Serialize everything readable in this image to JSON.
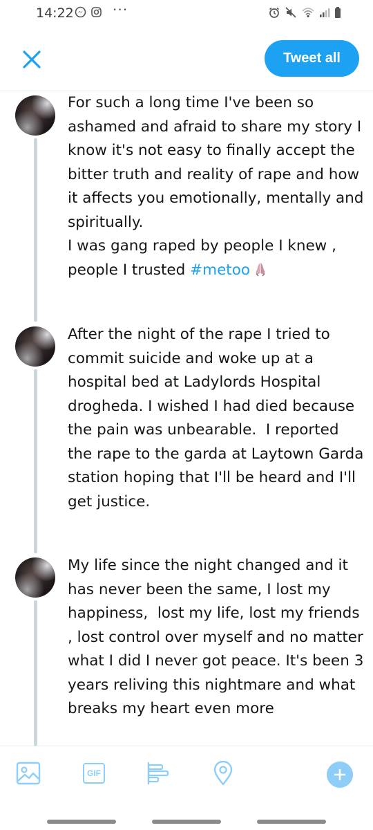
{
  "status_bar": {
    "time": "14:22",
    "left_icons": [
      "messenger-icon",
      "instagram-icon"
    ],
    "more": "···",
    "right_icons": [
      "alarm-icon",
      "mute-icon",
      "wifi-icon",
      "signal-icon",
      "battery-icon"
    ]
  },
  "header": {
    "close_icon": "close-icon",
    "tweet_all_label": "Tweet all"
  },
  "colors": {
    "accent": "#1da1f2",
    "accent_disabled": "#8ecdf7",
    "thread_line": "#ccd6dd",
    "text": "#14171a"
  },
  "tweets": [
    {
      "text": "For such a long time I've been so ashamed and afraid to share my story I know it's not easy to finally accept the bitter truth and reality of rape and how it affects you emotionally, mentally and spiritually.\nI was gang raped by people I knew , people I trusted ",
      "hashtag": "#metoo",
      "emoji": "praying-hands-emoji"
    },
    {
      "text": "After the night of the rape I tried to commit suicide and woke up at a hospital bed at Ladylords Hospital drogheda. I wished I had died because the pain was unbearable.  I reported the rape to the garda at Laytown Garda station hoping that I'll be heard and I'll get justice."
    },
    {
      "text": "My life since the night changed and it has never been the same, I lost my happiness,  lost my life, lost my friends , lost control over myself and no matter what I did I never got peace. It's been 3 years reliving this nightmare and what breaks my heart even more"
    }
  ],
  "toolbar": {
    "items": [
      "image-icon",
      "gif-icon",
      "poll-icon",
      "location-icon"
    ],
    "gif_label": "GIF",
    "add_icon": "plus-icon"
  }
}
